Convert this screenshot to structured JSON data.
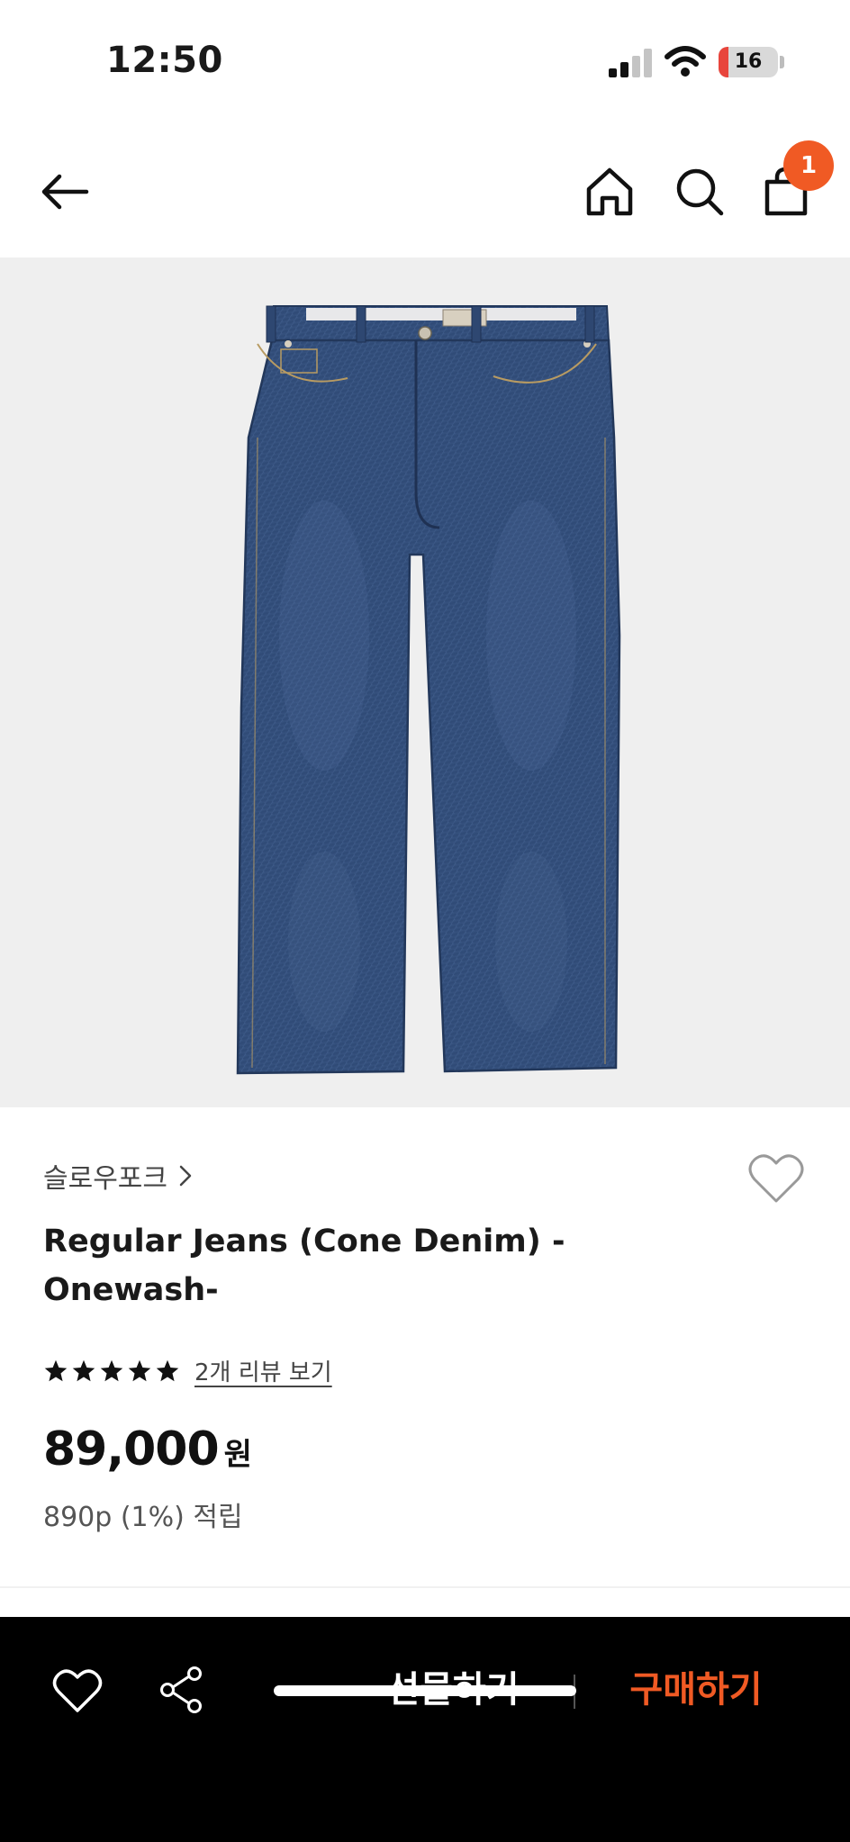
{
  "status_bar": {
    "time": "12:50",
    "battery_level": "16",
    "battery_fraction": 0.16,
    "signal_icon": "cellular-signal-icon",
    "wifi_icon": "wifi-icon"
  },
  "nav": {
    "back_icon": "arrow-left-icon",
    "home_icon": "home-icon",
    "search_icon": "search-icon",
    "cart_icon": "shopping-bag-icon",
    "cart_count": "1"
  },
  "product": {
    "brand": "슬로우포크",
    "title_line1": "Regular Jeans (Cone Denim) -",
    "title_line2": "Onewash-",
    "rating_stars": 5,
    "review_link": "2개 리뷰 보기",
    "price": "89,000",
    "currency": "원",
    "points": "890p (1%) 적립"
  },
  "bottom_bar": {
    "gift_label": "선물하기",
    "buy_label": "구매하기"
  },
  "colors": {
    "accent": "#f05a24",
    "bottom_bar_bg": "#000000",
    "image_bg": "#efefef",
    "denim": "#34507d"
  }
}
